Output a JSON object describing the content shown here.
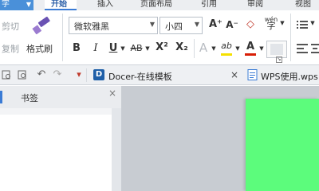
{
  "menubar": {
    "app_label": "字",
    "tabs": [
      {
        "label": "开始",
        "active": true
      },
      {
        "label": "插入"
      },
      {
        "label": "页面布局"
      },
      {
        "label": "引用"
      },
      {
        "label": "审阅"
      },
      {
        "label": "视图"
      }
    ]
  },
  "ribbon": {
    "cut_label": "剪切",
    "copy_label": "复制",
    "format_painter_label": "格式刷",
    "font_name": "微软雅黑",
    "font_size": "小四",
    "bold": "B",
    "italic": "I",
    "underline": "U",
    "strikethrough": "AB",
    "superscript": "X²",
    "subscript": "X₂",
    "grow_font": "A⁺",
    "shrink_font": "A⁻",
    "clear_format": "◇",
    "pinyin": "wén",
    "text_effect": "A",
    "highlight": "ab",
    "font_color": "A",
    "colors": {
      "font_color_bar": "#d81e06",
      "highlight_bar": "#f5e000",
      "accent": "#3a7bd5"
    }
  },
  "quickbar": {
    "doc_tabs": [
      {
        "icon_letter": "D",
        "label": "Docer-在线模板",
        "close": "×"
      },
      {
        "icon_letter": "W",
        "label": "WPS使用.wps"
      }
    ]
  },
  "sidepane": {
    "tab_label": "书签",
    "close": "×"
  },
  "canvas": {
    "page_color": "#5cfc7c"
  }
}
